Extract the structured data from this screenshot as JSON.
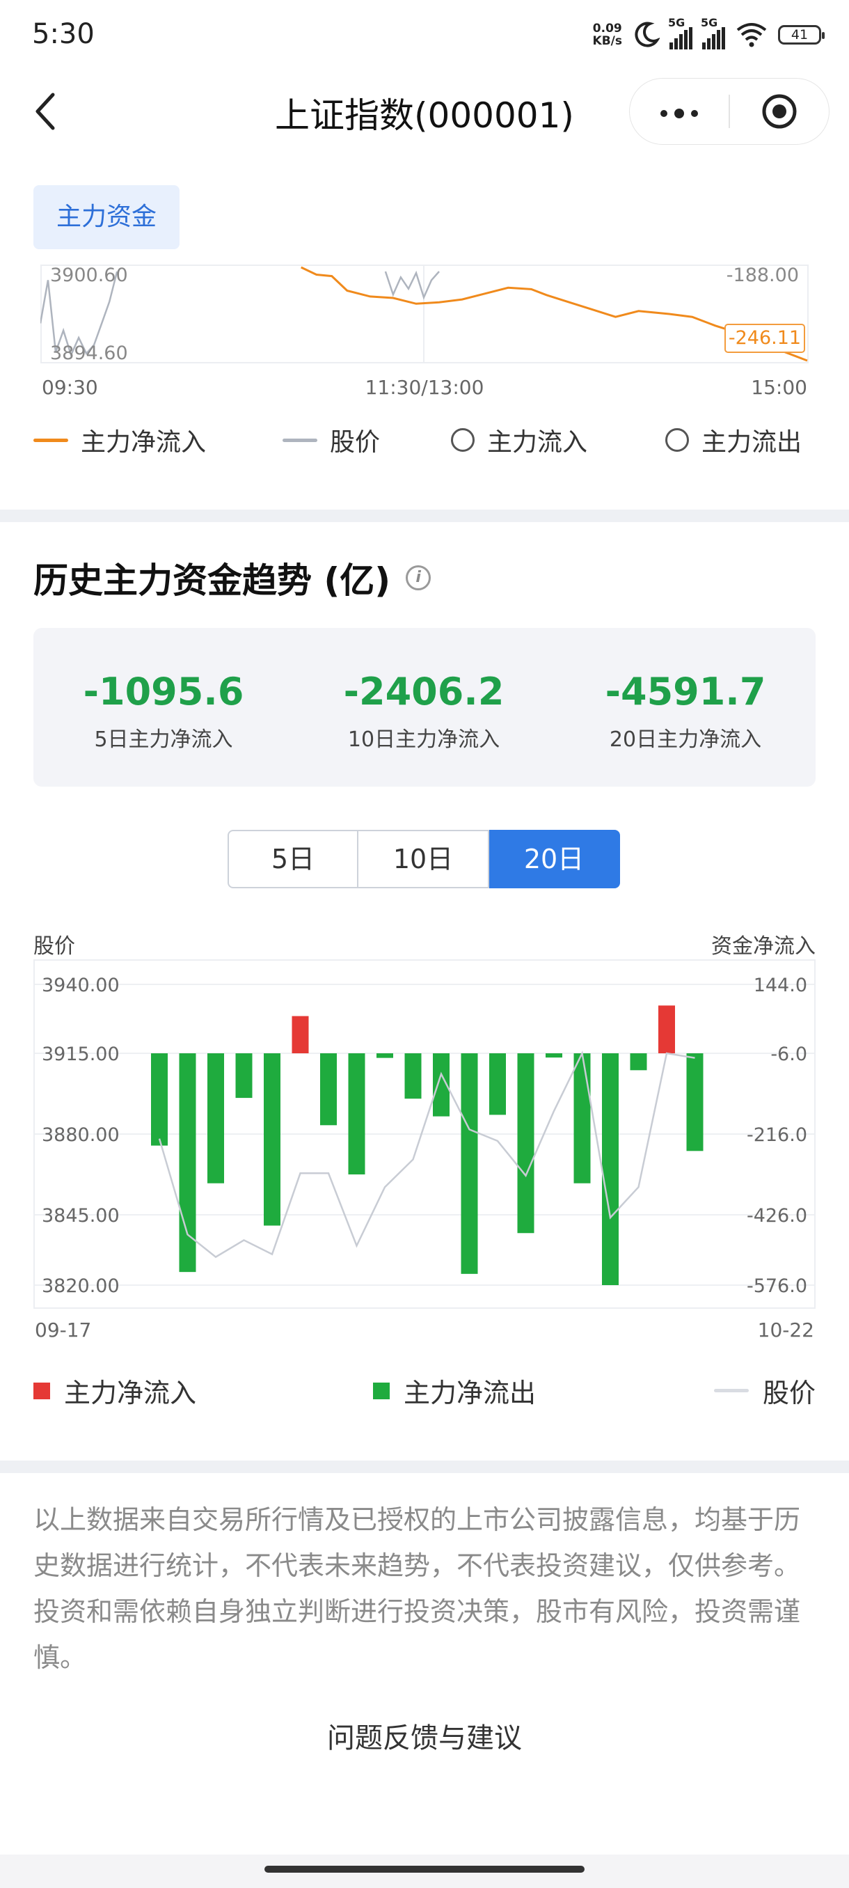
{
  "status_bar": {
    "time": "5:30",
    "net_speed_value": "0.09",
    "net_speed_unit": "KB/s",
    "signal1_label": "5G",
    "signal2_label": "5G",
    "battery": "41"
  },
  "nav": {
    "title": "上证指数(000001)"
  },
  "intraday": {
    "tab_label": "主力资金",
    "y_left_top": "3900.60",
    "y_left_bottom": "3894.60",
    "y_right_top": "-188.00",
    "y_right_bottom": "-246.11",
    "x_start": "09:30",
    "x_mid": "11:30/13:00",
    "x_end": "15:00",
    "legend": {
      "net_inflow": "主力净流入",
      "price": "股价",
      "inflow": "主力流入",
      "outflow": "主力流出"
    },
    "chart_data": {
      "type": "line",
      "series": [
        {
          "name": "主力净流入",
          "x": [
            0.34,
            0.36,
            0.38,
            0.4,
            0.43,
            0.46,
            0.49,
            0.52,
            0.55,
            0.58,
            0.61,
            0.64,
            0.66,
            0.69,
            0.72,
            0.75,
            0.78,
            0.8,
            0.82,
            0.85,
            0.88,
            0.91,
            0.94,
            0.97,
            1.0
          ],
          "values": [
            -188,
            -193,
            -194,
            -204,
            -208,
            -209,
            -213,
            -212,
            -210,
            -206,
            -202,
            -203,
            -207,
            -212,
            -217,
            -222,
            -218,
            -219,
            -220,
            -222,
            -228,
            -233,
            -240,
            -246,
            -252
          ]
        },
        {
          "name": "股价",
          "x": [
            0.0,
            0.01,
            0.02,
            0.03,
            0.04,
            0.05,
            0.06,
            0.07,
            0.08,
            0.09,
            0.1,
            0.45,
            0.46,
            0.47,
            0.48,
            0.49,
            0.5,
            0.51,
            0.52
          ],
          "values": [
            3897.0,
            3900.0,
            3895.0,
            3896.5,
            3894.8,
            3896.0,
            3894.9,
            3895.5,
            3897.0,
            3898.5,
            3900.6,
            3900.6,
            3899.0,
            3900.2,
            3899.4,
            3900.5,
            3898.8,
            3900.0,
            3900.6
          ]
        }
      ]
    }
  },
  "history": {
    "title": "历史主力资金趋势 (亿)",
    "summary": [
      {
        "value": "-1095.6",
        "label": "5日主力净流入"
      },
      {
        "value": "-2406.2",
        "label": "10日主力净流入"
      },
      {
        "value": "-4591.7",
        "label": "20日主力净流入"
      }
    ],
    "segments": [
      "5日",
      "10日",
      "20日"
    ],
    "active_segment": "20日",
    "left_axis_title": "股价",
    "right_axis_title": "资金净流入",
    "x_start": "09-17",
    "x_end": "10-22",
    "legend": {
      "inflow": "主力净流入",
      "outflow": "主力净流出",
      "price": "股价"
    },
    "colors": {
      "inflow": "#e53935",
      "outflow": "#1fab3e",
      "price": "#c8ccd4"
    },
    "chart_data": {
      "type": "bar",
      "y_left_ticks": [
        "3940.00",
        "3915.00",
        "3880.00",
        "3845.00",
        "3820.00"
      ],
      "y_right_ticks": [
        "144.0",
        "-6.0",
        "-216.0",
        "-426.0",
        "-576.0"
      ],
      "ylim_left": [
        3820,
        3940
      ],
      "ylim_right": [
        -576,
        144
      ],
      "series": [
        {
          "name": "资金净流入",
          "values": [
            -246,
            -548,
            -344,
            -122,
            -449,
            75,
            -193,
            -321,
            -18,
            -124,
            -170,
            -552,
            -166,
            -465,
            -17,
            -344,
            -594,
            -50,
            98,
            -260
          ]
        },
        {
          "name": "股价",
          "values": [
            3878,
            3838,
            3830,
            3836,
            3831,
            3863,
            3863,
            3834,
            3857,
            3869,
            3906,
            3882,
            3877,
            3862,
            3890,
            3915,
            3844,
            3857,
            3915,
            3913
          ]
        }
      ]
    }
  },
  "disclaimer": "以上数据来自交易所行情及已授权的上市公司披露信息，均基于历史数据进行统计，不代表未来趋势，不代表投资建议，仅供参考。投资和需依赖自身独立判断进行投资决策，股市有风险，投资需谨慎。",
  "feedback": "问题反馈与建议"
}
